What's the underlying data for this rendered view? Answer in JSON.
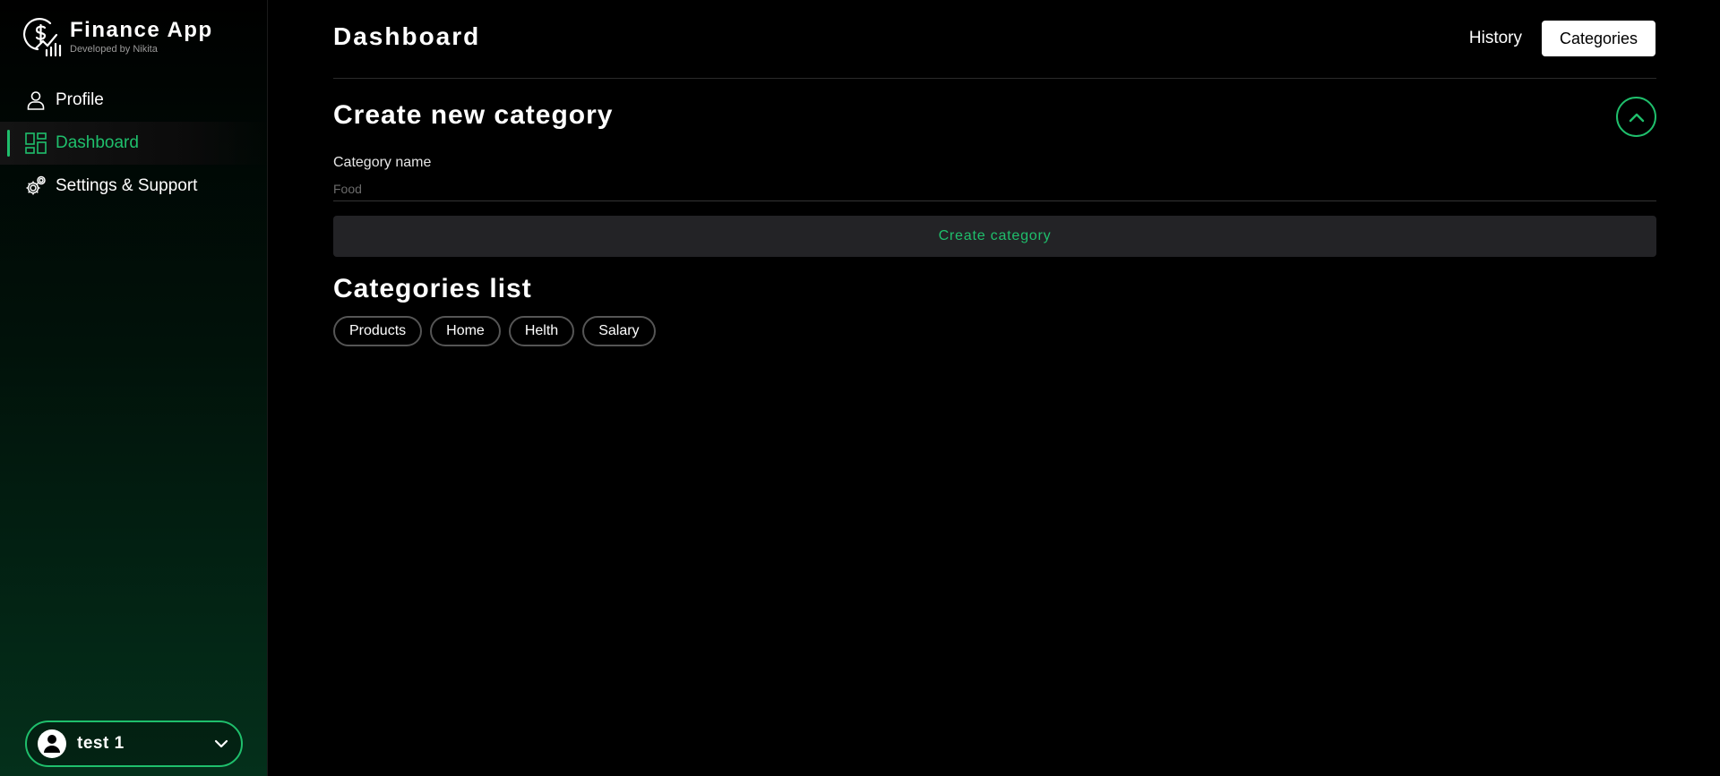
{
  "app": {
    "title": "Finance App",
    "subtitle": "Developed by Nikita"
  },
  "sidebar": {
    "items": [
      {
        "label": "Profile",
        "icon": "user-icon",
        "active": false
      },
      {
        "label": "Dashboard",
        "icon": "dashboard-grid-icon",
        "active": true
      },
      {
        "label": "Settings & Support",
        "icon": "gear-icon",
        "active": false
      }
    ],
    "user": {
      "name": "test 1"
    }
  },
  "header": {
    "title": "Dashboard",
    "history_label": "History",
    "categories_label": "Categories"
  },
  "create_form": {
    "title": "Create new category",
    "field_label": "Category name",
    "placeholder": "Food",
    "value": "",
    "submit_label": "Create category"
  },
  "categories": {
    "title": "Categories list",
    "items": [
      "Products",
      "Home",
      "Helth",
      "Salary"
    ]
  },
  "colors": {
    "accent": "#1fbf6c",
    "background": "#000000",
    "button_bg": "#232326"
  }
}
